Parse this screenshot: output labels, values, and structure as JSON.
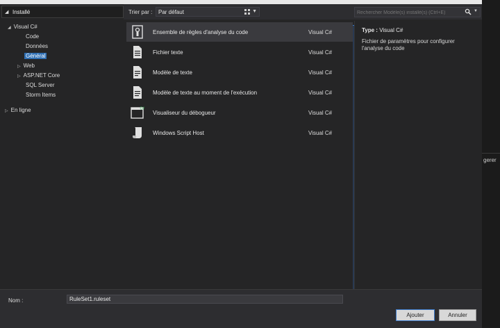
{
  "tree": {
    "installed_label": "Installé",
    "nodes": [
      {
        "label": "Visual C#",
        "tri": "◢"
      },
      {
        "label": "Code"
      },
      {
        "label": "Données"
      },
      {
        "label": "Général",
        "selected": true
      },
      {
        "label": "Web",
        "tri": "▷"
      },
      {
        "label": "ASP.NET Core",
        "tri": "▷"
      },
      {
        "label": "SQL Server"
      },
      {
        "label": "Storm Items"
      },
      {
        "label": "En ligne",
        "tri": "▷"
      }
    ]
  },
  "toolbar": {
    "sort_label": "Trier par :",
    "sort_value": "Par défaut",
    "search_placeholder": "Rechercher Modèle(s) installé(s) (Ctrl+E)"
  },
  "templates": [
    {
      "name": "Ensemble de règles d'analyse du code",
      "language": "Visual C#",
      "icon": "ruleset-icon",
      "selected": true
    },
    {
      "name": "Fichier texte",
      "language": "Visual C#",
      "icon": "text-file-icon"
    },
    {
      "name": "Modèle de texte",
      "language": "Visual C#",
      "icon": "text-template-icon"
    },
    {
      "name": "Modèle de texte au moment de l'exécution",
      "language": "Visual C#",
      "icon": "runtime-text-template-icon"
    },
    {
      "name": "Visualiseur du débogueur",
      "language": "Visual C#",
      "icon": "debugger-visualizer-icon"
    },
    {
      "name": "Windows Script Host",
      "language": "Visual C#",
      "icon": "script-host-icon"
    }
  ],
  "details": {
    "type_label": "Type :",
    "type_value": "Visual C#",
    "description": "Fichier de paramètres pour configurer l'analyse du code"
  },
  "bottom": {
    "name_label": "Nom :",
    "name_value": "RuleSet1.ruleset",
    "ok_label": "Ajouter",
    "cancel_label": "Annuler"
  },
  "outside": {
    "peek_text": "gerer"
  },
  "colors": {
    "accent": "#3b78c8",
    "selection": "#2f6fb3"
  }
}
